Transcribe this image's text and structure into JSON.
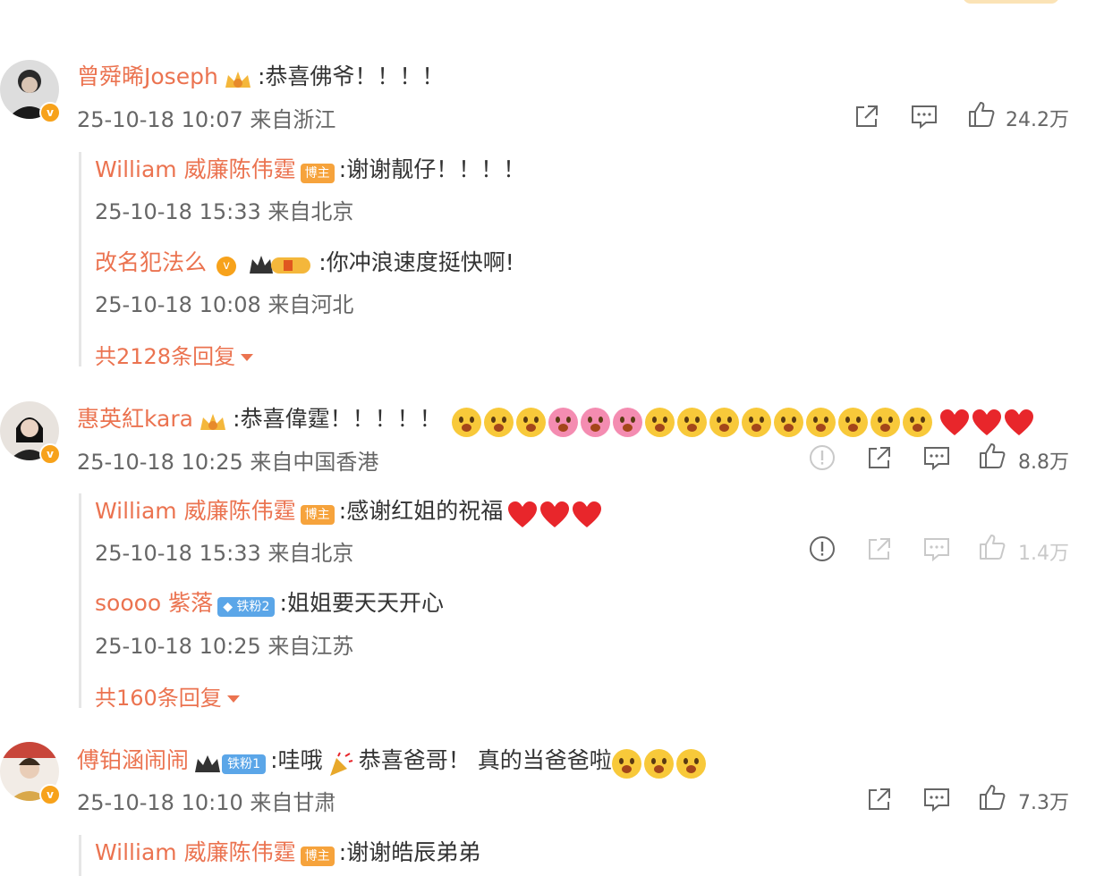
{
  "comments": [
    {
      "name": "曾舜晞Joseph",
      "colon": ":",
      "text": "恭喜佛爷！！！！",
      "meta": "25-10-18 10:07 来自浙江",
      "likes": "24.2万",
      "replies": [
        {
          "name": "William 威廉陈伟霆",
          "badge": "博主",
          "colon": ":",
          "text": "谢谢靓仔！！！！",
          "meta": "25-10-18 15:33 来自北京"
        },
        {
          "name": "改名犯法么",
          "colon": ":",
          "text": "你冲浪速度挺快啊!",
          "meta": "25-10-18 10:08 来自河北"
        }
      ],
      "more": "共2128条回复"
    },
    {
      "name": "惠英紅kara",
      "colon": ":",
      "text": "恭喜偉霆！！！！！",
      "meta": "25-10-18 10:25 来自中国香港",
      "likes": "8.8万",
      "replies": [
        {
          "name": "William 威廉陈伟霆",
          "badge": "博主",
          "colon": ":",
          "text": "感谢红姐的祝福",
          "meta": "25-10-18 15:33 来自北京",
          "likes": "1.4万"
        },
        {
          "name": "soooo 紫落",
          "badge": "铁粉2",
          "colon": ":",
          "text": "姐姐要天天开心",
          "meta": "25-10-18 10:25 来自江苏"
        }
      ],
      "more": "共160条回复"
    },
    {
      "name": "傅铂涵闹闹",
      "badge": "铁粉1",
      "colon": ":",
      "text1": "哇哦",
      "text2": "恭喜爸哥！ 真的当爸爸啦",
      "meta": "25-10-18 10:10 来自甘肃",
      "likes": "7.3万",
      "replies": [
        {
          "name": "William 威廉陈伟霆",
          "badge": "博主",
          "colon": ":",
          "text": "谢谢皓辰弟弟"
        }
      ]
    }
  ],
  "icons": {
    "verified": "v",
    "actions": [
      "report-icon",
      "share-icon",
      "comment-icon",
      "like-icon"
    ]
  },
  "colors": {
    "name": "#eb7350",
    "blogger_badge": "#f6a33c",
    "fan_badge": "#5ba6e8",
    "verified": "#f7a21b"
  }
}
